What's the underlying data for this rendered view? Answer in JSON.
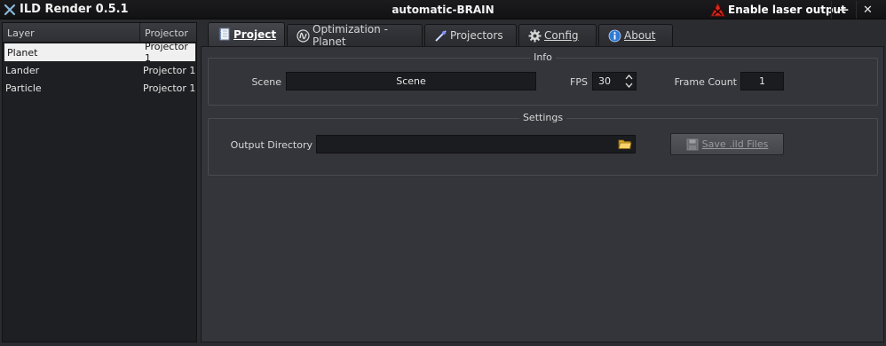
{
  "titlebar": {
    "app_title": "ILD Render 0.5.1",
    "document_title": "automatic-BRAIN",
    "laser_button_label": "Enable laser output",
    "laser_icon": "laser-warning-icon",
    "minimize_label": "—",
    "close_label": "✕"
  },
  "layers_panel": {
    "headers": {
      "layer": "Layer",
      "projector": "Projector"
    },
    "rows": [
      {
        "layer": "Planet",
        "projector": "Projector 1",
        "selected": true
      },
      {
        "layer": "Lander",
        "projector": "Projector 1",
        "selected": false
      },
      {
        "layer": "Particle",
        "projector": "Projector 1",
        "selected": false
      }
    ]
  },
  "tabs": [
    {
      "label": "Project",
      "icon": "notebook-icon",
      "active": true
    },
    {
      "label": "Optimization - Planet",
      "icon": "wave-icon",
      "active": false
    },
    {
      "label": "Projectors",
      "icon": "laser-beam-icon",
      "active": false
    },
    {
      "label": "Config",
      "icon": "gear-icon",
      "active": false
    },
    {
      "label": "About",
      "icon": "info-icon",
      "active": false
    }
  ],
  "info_group": {
    "title": "Info",
    "scene_label": "Scene",
    "scene_value": "Scene",
    "fps_label": "FPS",
    "fps_value": "30",
    "frame_count_label": "Frame Count",
    "frame_count_value": "1"
  },
  "settings_group": {
    "title": "Settings",
    "output_dir_label": "Output Directory",
    "output_dir_value": "",
    "folder_icon": "folder-icon",
    "save_button_label": "Save .ild Files",
    "save_icon": "floppy-disk-icon"
  },
  "colors": {
    "background": "#34353a",
    "titlebar": "#151517",
    "field": "#1b1c1f",
    "selected_row": "#f0f0f0"
  }
}
